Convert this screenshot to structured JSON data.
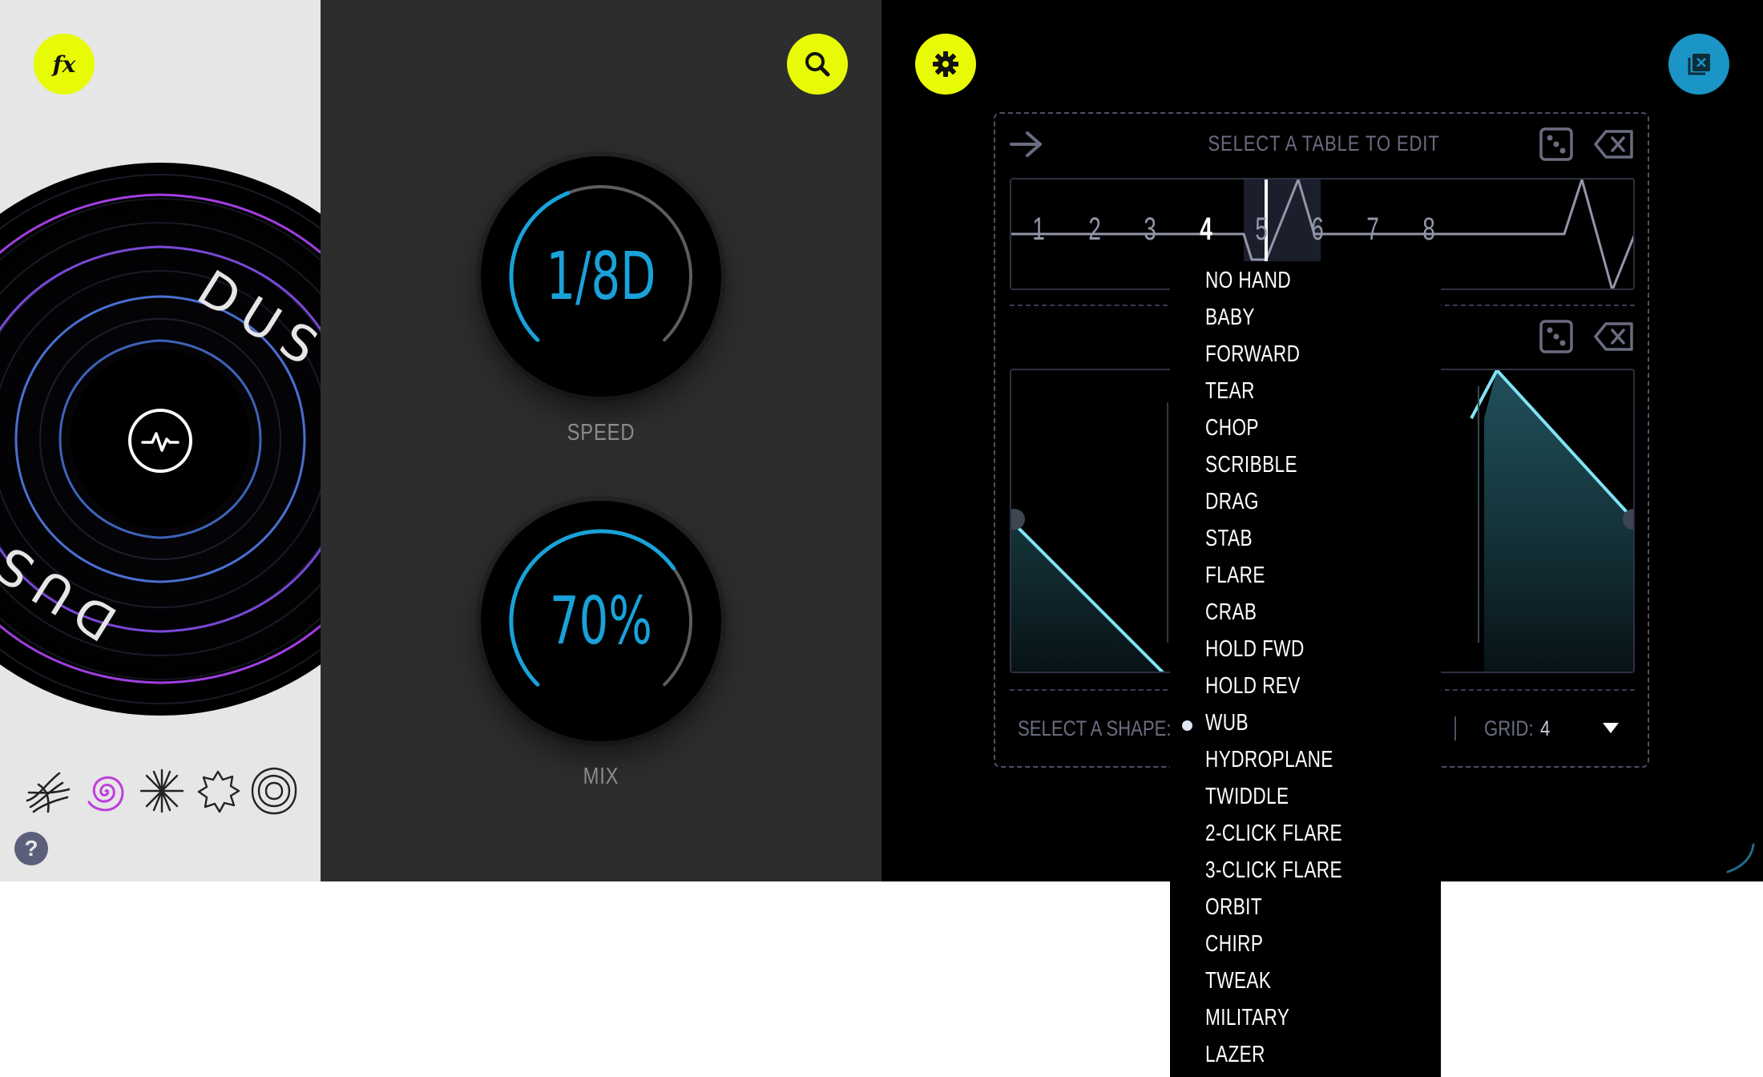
{
  "left_panel": {
    "fx_label": "fx",
    "disc_text": "DUST",
    "shape_icons": [
      "tangle-shape-icon",
      "spiral-shape-icon",
      "burst-shape-icon",
      "leaf-shape-icon",
      "ripple-shape-icon"
    ],
    "selected_shape_index": 1,
    "help_label": "?"
  },
  "middle_panel": {
    "speed": {
      "value": "1/8D",
      "label": "SPEED",
      "level": 0.42
    },
    "mix": {
      "value": "70%",
      "label": "MIX",
      "level": 0.7
    }
  },
  "right_panel": {
    "header_title": "SELECT A TABLE TO EDIT",
    "tables": [
      "1",
      "2",
      "3",
      "4",
      "5",
      "6",
      "7",
      "8"
    ],
    "selected_table_index": 3,
    "select_shape_label": "SELECT A SHAPE:",
    "grid_label": "GRID:",
    "grid_value": "4"
  },
  "dropdown": {
    "selected": "WUB",
    "items": [
      "NO HAND",
      "BABY",
      "FORWARD",
      "TEAR",
      "CHOP",
      "SCRIBBLE",
      "DRAG",
      "STAB",
      "FLARE",
      "CRAB",
      "HOLD FWD",
      "HOLD REV",
      "WUB",
      "HYDROPLANE",
      "TWIDDLE",
      "2-CLICK FLARE",
      "3-CLICK FLARE",
      "ORBIT",
      "CHIRP",
      "TWEAK",
      "MILITARY",
      "LAZER"
    ]
  },
  "colors": {
    "accent_yellow": "#e8fb06",
    "knob_blue": "#19a2d9",
    "button_blue": "#1a95c5",
    "curve_cyan": "#7fe3f5",
    "ring_purple": "#a23ee0"
  }
}
